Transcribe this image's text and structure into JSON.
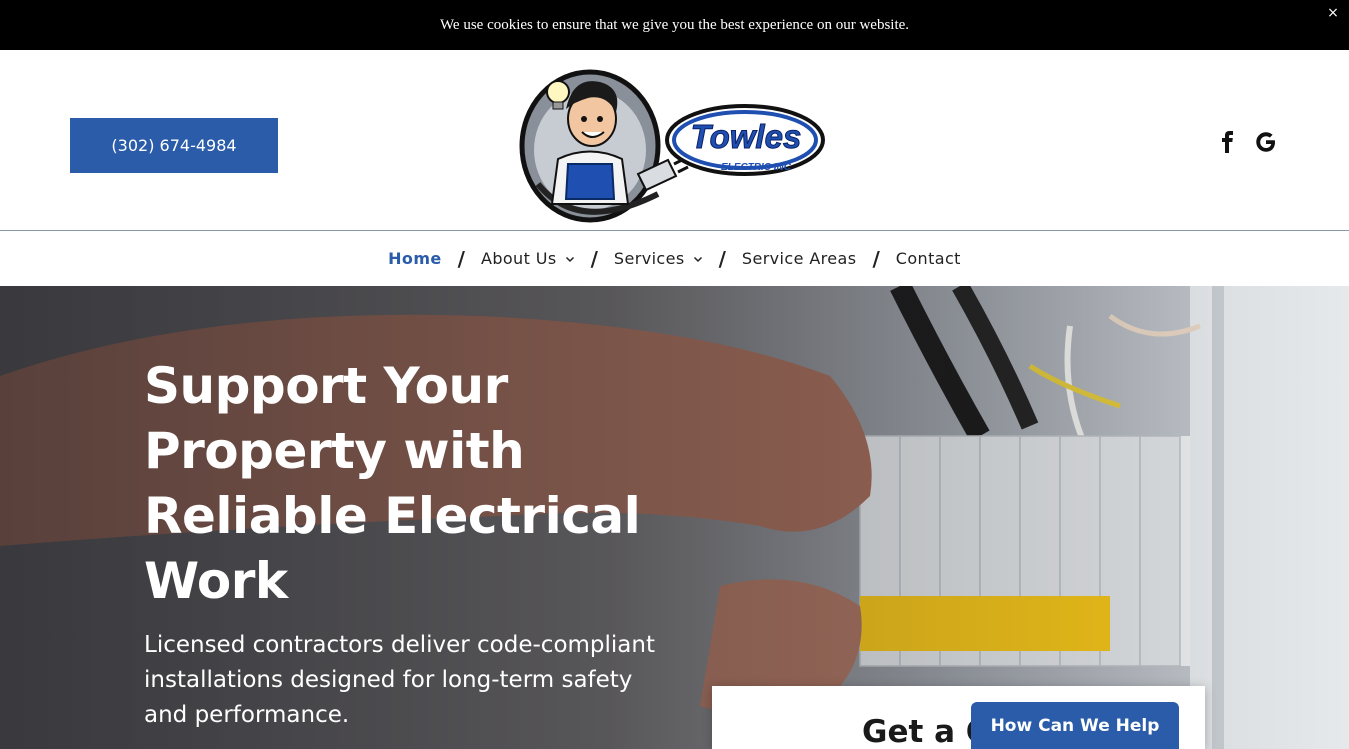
{
  "cookie_bar": {
    "message": "We use cookies to ensure that we give you the best experience on our website.",
    "close_label": "×"
  },
  "header": {
    "phone": "(302) 674-4984",
    "logo": {
      "brand": "Towles",
      "sub": "ELECTRIC INC"
    },
    "social": [
      "facebook-icon",
      "google-icon"
    ]
  },
  "nav": {
    "items": [
      {
        "label": "Home",
        "active": true
      },
      {
        "label": "About Us",
        "dropdown": true
      },
      {
        "label": "Services",
        "dropdown": true
      },
      {
        "label": "Service Areas"
      },
      {
        "label": "Contact"
      }
    ],
    "separator": "/"
  },
  "hero": {
    "title": "Support Your Property with Reliable Electrical Work",
    "subtitle": "Licensed contractors deliver code-compliant installations designed for long-term safety and performance."
  },
  "quote_card": {
    "title": "Get a Q"
  },
  "help_button": {
    "label": "How Can We Help"
  },
  "colors": {
    "accent": "#2a5caa",
    "cookie_bg": "#000000",
    "breaker_yellow": "#f2c318"
  }
}
